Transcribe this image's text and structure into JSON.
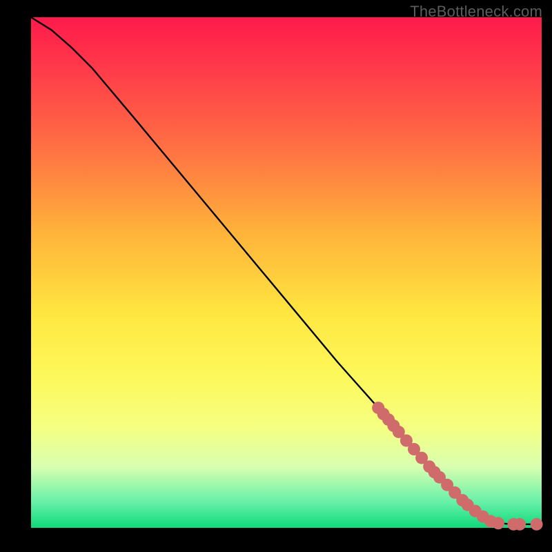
{
  "watermark": "TheBottleneck.com",
  "colors": {
    "marker": "#cf6b6b",
    "curve": "#000000",
    "frame_bg": "#000000"
  },
  "chart_data": {
    "type": "line",
    "title": "",
    "xlabel": "",
    "ylabel": "",
    "xlim": [
      0,
      100
    ],
    "ylim": [
      0,
      100
    ],
    "grid": false,
    "legend": false,
    "curve": [
      {
        "x": 0,
        "y": 100
      },
      {
        "x": 4,
        "y": 97.5
      },
      {
        "x": 8,
        "y": 94
      },
      {
        "x": 12,
        "y": 90
      },
      {
        "x": 20,
        "y": 80.5
      },
      {
        "x": 30,
        "y": 68.5
      },
      {
        "x": 40,
        "y": 56.5
      },
      {
        "x": 50,
        "y": 44.5
      },
      {
        "x": 60,
        "y": 32.5
      },
      {
        "x": 68,
        "y": 23.5
      },
      {
        "x": 74,
        "y": 16.5
      },
      {
        "x": 80,
        "y": 10
      },
      {
        "x": 84,
        "y": 6
      },
      {
        "x": 88,
        "y": 2.5
      },
      {
        "x": 91,
        "y": 1
      },
      {
        "x": 94,
        "y": 0.7
      },
      {
        "x": 100,
        "y": 0.7
      }
    ],
    "markers": [
      {
        "x": 68.0,
        "y": 23.5
      },
      {
        "x": 69.0,
        "y": 22.3
      },
      {
        "x": 70.0,
        "y": 21.2
      },
      {
        "x": 71.0,
        "y": 20.0
      },
      {
        "x": 72.0,
        "y": 18.8
      },
      {
        "x": 73.5,
        "y": 17.1
      },
      {
        "x": 75.0,
        "y": 15.4
      },
      {
        "x": 76.5,
        "y": 13.7
      },
      {
        "x": 78.0,
        "y": 12.0
      },
      {
        "x": 79.0,
        "y": 10.9
      },
      {
        "x": 80.0,
        "y": 9.9
      },
      {
        "x": 81.5,
        "y": 8.4
      },
      {
        "x": 83.0,
        "y": 6.9
      },
      {
        "x": 84.5,
        "y": 5.4
      },
      {
        "x": 85.5,
        "y": 4.5
      },
      {
        "x": 87.0,
        "y": 3.3
      },
      {
        "x": 88.5,
        "y": 2.2
      },
      {
        "x": 90.0,
        "y": 1.3
      },
      {
        "x": 91.5,
        "y": 0.9
      },
      {
        "x": 94.5,
        "y": 0.7
      },
      {
        "x": 95.7,
        "y": 0.7
      },
      {
        "x": 99.0,
        "y": 0.7
      }
    ]
  }
}
